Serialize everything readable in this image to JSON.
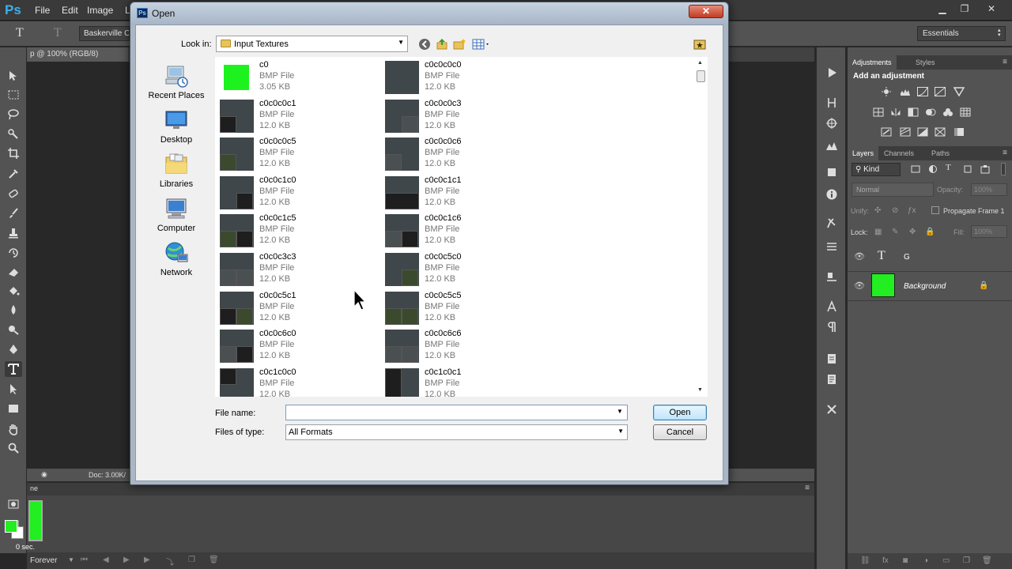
{
  "photoshop": {
    "logo": "Ps",
    "menu": [
      "File",
      "Edit",
      "Image",
      "L"
    ],
    "font_family_value": "Baskerville Ol",
    "workspace": "Essentials",
    "doc_tab": "p @ 100% (RGB/8)",
    "doc_tab_close": "c",
    "doc_info": "Doc: 3.00K/",
    "frame_delay": "0 sec.",
    "loop_option": "Forever",
    "timeline_header_fragment": "ne"
  },
  "adjustments_panel": {
    "tabs": [
      "Adjustments",
      "Styles"
    ],
    "heading": "Add an adjustment"
  },
  "layers_panel": {
    "tabs": [
      "Layers",
      "Channels",
      "Paths"
    ],
    "kind_filter": "Kind",
    "blend_mode": "Normal",
    "opacity_label": "Opacity:",
    "opacity_value": "100%",
    "unify_label": "Unify:",
    "propagate_label": "Propagate Frame 1",
    "lock_label": "Lock:",
    "fill_label": "Fill:",
    "fill_value": "100%",
    "layers": [
      {
        "name": "G",
        "kind": "text"
      },
      {
        "name": "Background",
        "kind": "image",
        "thumb_color": "#22ee22"
      }
    ]
  },
  "dialog": {
    "title": "Open",
    "close_glyph": "✕",
    "look_in_label": "Look in:",
    "look_in_value": "Input Textures",
    "places": [
      "Recent Places",
      "Desktop",
      "Libraries",
      "Computer",
      "Network"
    ],
    "file_name_label": "File name:",
    "file_name_value": "",
    "files_of_type_label": "Files of type:",
    "files_of_type_value": "All Formats",
    "open_button": "Open",
    "cancel_button": "Cancel",
    "files": [
      {
        "name": "c0",
        "type": "BMP File",
        "size": "3.05 KB"
      },
      {
        "name": "c0c0c0c0",
        "type": "BMP File",
        "size": "12.0 KB"
      },
      {
        "name": "c0c0c0c1",
        "type": "BMP File",
        "size": "12.0 KB"
      },
      {
        "name": "c0c0c0c3",
        "type": "BMP File",
        "size": "12.0 KB"
      },
      {
        "name": "c0c0c0c5",
        "type": "BMP File",
        "size": "12.0 KB"
      },
      {
        "name": "c0c0c0c6",
        "type": "BMP File",
        "size": "12.0 KB"
      },
      {
        "name": "c0c0c1c0",
        "type": "BMP File",
        "size": "12.0 KB"
      },
      {
        "name": "c0c0c1c1",
        "type": "BMP File",
        "size": "12.0 KB"
      },
      {
        "name": "c0c0c1c5",
        "type": "BMP File",
        "size": "12.0 KB"
      },
      {
        "name": "c0c0c1c6",
        "type": "BMP File",
        "size": "12.0 KB"
      },
      {
        "name": "c0c0c3c3",
        "type": "BMP File",
        "size": "12.0 KB"
      },
      {
        "name": "c0c0c5c0",
        "type": "BMP File",
        "size": "12.0 KB"
      },
      {
        "name": "c0c0c5c1",
        "type": "BMP File",
        "size": "12.0 KB"
      },
      {
        "name": "c0c0c5c5",
        "type": "BMP File",
        "size": "12.0 KB"
      },
      {
        "name": "c0c0c6c0",
        "type": "BMP File",
        "size": "12.0 KB"
      },
      {
        "name": "c0c0c6c6",
        "type": "BMP File",
        "size": "12.0 KB"
      },
      {
        "name": "c0c1c0c0",
        "type": "BMP File",
        "size": "12.0 KB"
      },
      {
        "name": "c0c1c0c1",
        "type": "BMP File",
        "size": "12.0 KB"
      }
    ]
  },
  "colors": {
    "foreground": "#22ee22",
    "background": "#ffffff",
    "ps_logo": "#3ab0f0",
    "close_button": "#c23b22"
  }
}
